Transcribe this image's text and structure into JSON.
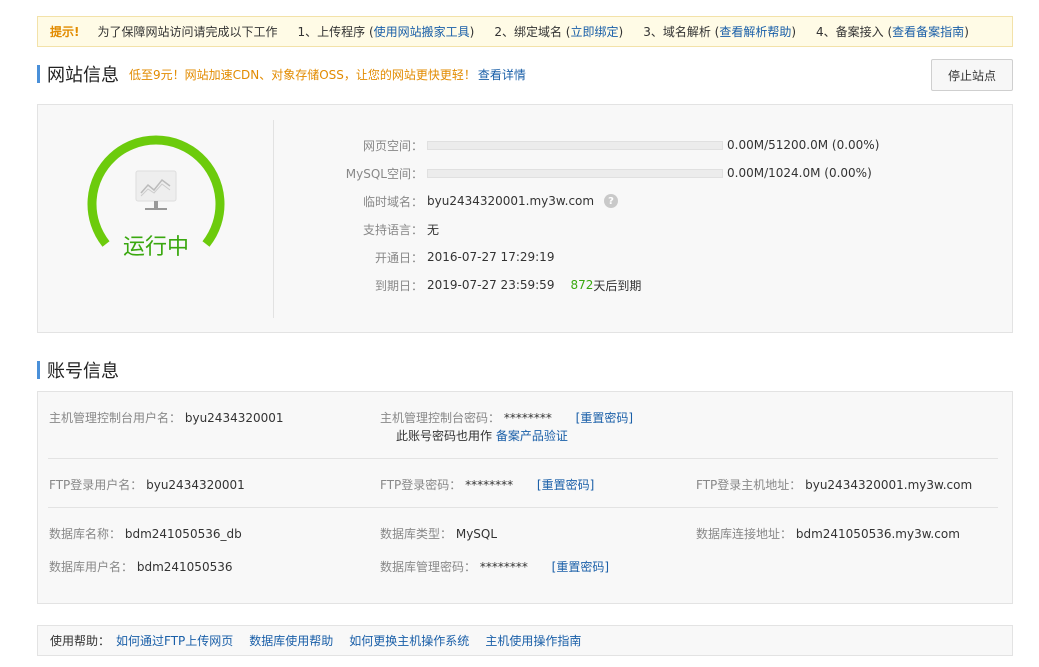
{
  "tip": {
    "label": "提示!",
    "intro": "为了保障网站访问请完成以下工作",
    "steps": [
      {
        "text": "1、上传程序 (",
        "link": "使用网站搬家工具",
        "end": ")"
      },
      {
        "text": "2、绑定域名 (",
        "link": "立即绑定",
        "end": ")"
      },
      {
        "text": "3、域名解析 (",
        "link": "查看解析帮助",
        "end": ")"
      },
      {
        "text": "4、备案接入 (",
        "link": "查看备案指南",
        "end": ")"
      }
    ]
  },
  "site": {
    "title": "网站信息",
    "promo": "低至9元！网站加速CDN、对象存储OSS，让您的网站更快更轻！",
    "promo_link": "查看详情",
    "stop_button": "停止站点",
    "status": "运行中",
    "colors": {
      "gauge": "#6ccb0c",
      "status": "#3aa80f"
    },
    "rows": {
      "web_space": {
        "label": "网页空间：",
        "value": "0.00M/51200.0M (0.00%)",
        "fraction": 0.0
      },
      "mysql_space": {
        "label": "MySQL空间：",
        "value": "0.00M/1024.0M (0.00%)",
        "fraction": 0.0
      },
      "temp_domain": {
        "label": "临时域名：",
        "value": "byu2434320001.my3w.com",
        "help": "?"
      },
      "languages": {
        "label": "支持语言：",
        "value": "无"
      },
      "open_date": {
        "label": "开通日：",
        "value": "2016-07-27 17:29:19"
      },
      "expire_date": {
        "label": "到期日：",
        "value": "2019-07-27 23:59:59",
        "days": "872",
        "days_suffix": "天后到期"
      }
    }
  },
  "account": {
    "title": "账号信息",
    "console_user": {
      "label": "主机管理控制台用户名：",
      "value": "byu2434320001"
    },
    "console_pwd": {
      "label": "主机管理控制台密码：",
      "value": "********",
      "reset": "[重置密码]",
      "note": "此账号密码也用作",
      "note_link": "备案产品验证"
    },
    "ftp_user": {
      "label": "FTP登录用户名：",
      "value": "byu2434320001"
    },
    "ftp_pwd": {
      "label": "FTP登录密码：",
      "value": "********",
      "reset": "[重置密码]"
    },
    "ftp_host": {
      "label": "FTP登录主机地址：",
      "value": "byu2434320001.my3w.com"
    },
    "db_name": {
      "label": "数据库名称：",
      "value": "bdm241050536_db"
    },
    "db_type": {
      "label": "数据库类型：",
      "value": "MySQL"
    },
    "db_host": {
      "label": "数据库连接地址：",
      "value": "bdm241050536.my3w.com"
    },
    "db_user": {
      "label": "数据库用户名：",
      "value": "bdm241050536"
    },
    "db_pwd": {
      "label": "数据库管理密码：",
      "value": "********",
      "reset": "[重置密码]"
    }
  },
  "help": {
    "label": "使用帮助：",
    "links": [
      "如何通过FTP上传网页",
      "数据库使用帮助",
      "如何更换主机操作系统",
      "主机使用操作指南"
    ]
  }
}
